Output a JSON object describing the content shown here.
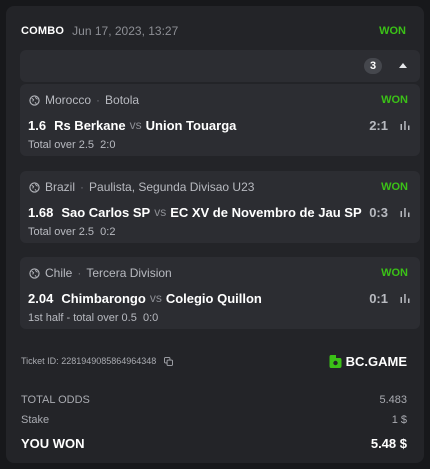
{
  "header": {
    "type": "COMBO",
    "date": "Jun 17, 2023, 13:27",
    "status": "WON"
  },
  "collapse": {
    "count": "3"
  },
  "bets": [
    {
      "country": "Morocco",
      "league": "Botola",
      "status": "WON",
      "odd": "1.6",
      "home": "Rs Berkane",
      "vs": "vs",
      "away": "Union Touarga",
      "score": "2:1",
      "market": "Total over 2.5",
      "result": "2:0"
    },
    {
      "country": "Brazil",
      "league": "Paulista, Segunda Divisao U23",
      "status": "WON",
      "odd": "1.68",
      "home": "Sao Carlos SP",
      "vs": "vs",
      "away": "EC XV de Novembro de Jau SP",
      "score": "0:3",
      "market": "Total over 2.5",
      "result": "0:2"
    },
    {
      "country": "Chile",
      "league": "Tercera Division",
      "status": "WON",
      "odd": "2.04",
      "home": "Chimbarongo",
      "vs": "vs",
      "away": "Colegio Quillon",
      "score": "0:1",
      "market": "1st half - total over 0.5",
      "result": "0:0"
    }
  ],
  "ticket": {
    "label": "Ticket ID:",
    "id": "2281949085864964348"
  },
  "brand": {
    "name": "BC.GAME",
    "color": "#3bc117"
  },
  "summary": {
    "total_odds_label": "TOTAL ODDS",
    "total_odds": "5.483",
    "stake_label": "Stake",
    "stake": "1 $",
    "won_label": "YOU WON",
    "won": "5.48 $"
  },
  "icons": {
    "league": "globe-icon",
    "stats": "bar-chart-icon",
    "copy": "copy-icon",
    "collapse": "caret-up-icon"
  },
  "colors": {
    "won": "#3bc117",
    "background": "#17181b",
    "card": "#232428",
    "panel": "#2c2d32"
  }
}
